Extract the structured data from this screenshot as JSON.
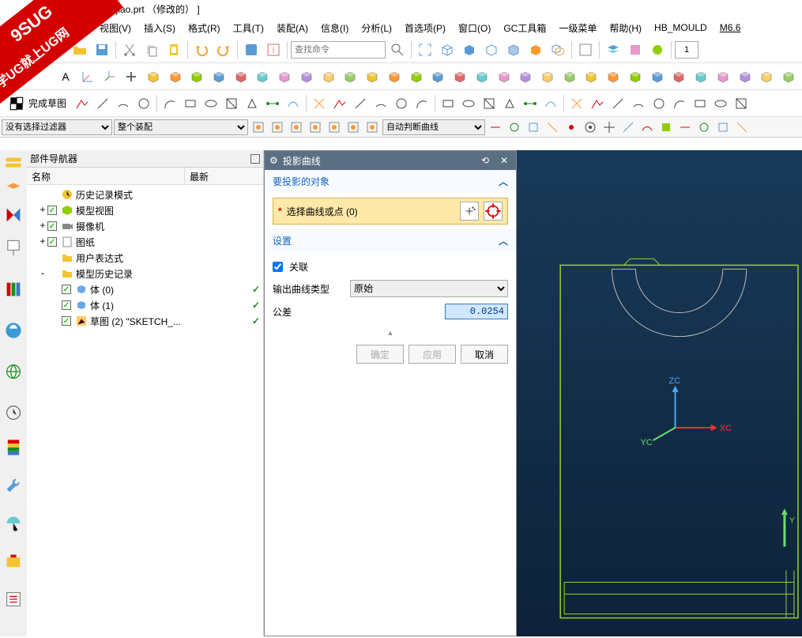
{
  "ribbon": {
    "line1": "9SUG",
    "line2": "学UG就上UG网"
  },
  "title": "ujiao.prt  （修改的） ]",
  "menu": [
    "视图(V)",
    "插入(S)",
    "格式(R)",
    "工具(T)",
    "装配(A)",
    "信息(I)",
    "分析(L)",
    "首选项(P)",
    "窗口(O)",
    "GC工具箱",
    "一级菜单",
    "帮助(H)",
    "HB_MOULD",
    "M6.6"
  ],
  "search_placeholder": "查找命令",
  "spin_value": "1",
  "finish_sketch": "完成草图",
  "filter": {
    "sel1": "没有选择过滤器",
    "sel2": "整个装配",
    "sel3": "自动判断曲线"
  },
  "navigator": {
    "title": "部件导航器",
    "col1": "名称",
    "col2": "最新",
    "rows": [
      {
        "indent": 0,
        "exp": "",
        "ck": false,
        "ico": "history",
        "label": "历史记录模式",
        "latest": false
      },
      {
        "indent": 0,
        "exp": "+",
        "ck": true,
        "ico": "view",
        "label": "模型视图",
        "latest": false
      },
      {
        "indent": 0,
        "exp": "+",
        "ck": true,
        "ico": "camera",
        "label": "摄像机",
        "latest": false
      },
      {
        "indent": 0,
        "exp": "+",
        "ck": true,
        "ico": "sheet",
        "label": "图纸",
        "latest": false
      },
      {
        "indent": 0,
        "exp": "",
        "ck": false,
        "ico": "folder",
        "label": "用户表达式",
        "latest": false
      },
      {
        "indent": 0,
        "exp": "-",
        "ck": false,
        "ico": "folder",
        "label": "模型历史记录",
        "latest": false
      },
      {
        "indent": 1,
        "exp": "",
        "ck": true,
        "ico": "body",
        "label": "体 (0)",
        "latest": true
      },
      {
        "indent": 1,
        "exp": "",
        "ck": true,
        "ico": "body",
        "label": "体 (1)",
        "latest": true
      },
      {
        "indent": 1,
        "exp": "",
        "ck": true,
        "ico": "sketch",
        "label": "草图 (2) \"SKETCH_...",
        "latest": true
      }
    ]
  },
  "dialog": {
    "title": "投影曲线",
    "sec1": "要投影的对象",
    "select_label": "选择曲线或点 (0)",
    "sec2": "设置",
    "assoc_label": "关联",
    "assoc_checked": true,
    "type_label": "输出曲线类型",
    "type_value": "原始",
    "tol_label": "公差",
    "tol_value": "0.0254",
    "ok": "确定",
    "apply": "应用",
    "cancel": "取消"
  },
  "axes": {
    "x": "XC",
    "y": "YC",
    "z": "ZC"
  }
}
